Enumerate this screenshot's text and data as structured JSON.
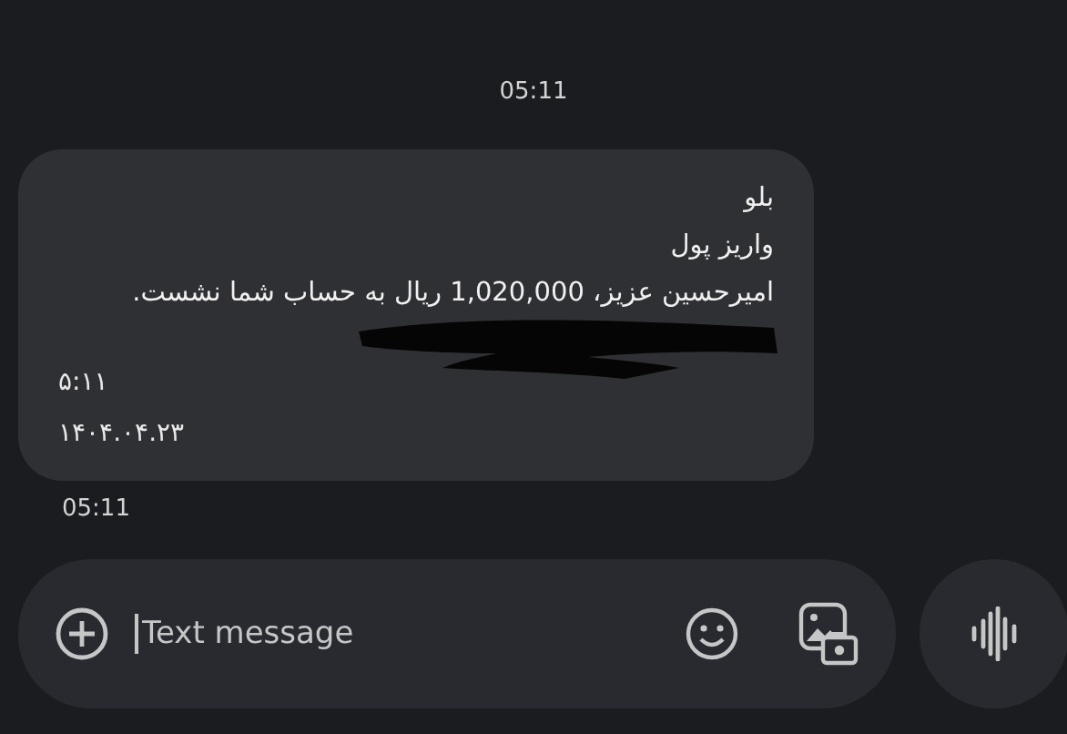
{
  "header_time": "05:11",
  "message": {
    "lines": [
      "بلو",
      "واریز پول",
      "امیرحسین عزیز، 1,020,000 ریال به حساب شما نشست."
    ],
    "redacted": true,
    "time": "۵:۱۱",
    "date": "۱۴۰۴.۰۴.۲۳"
  },
  "message_time": "05:11",
  "composer": {
    "placeholder": "Text message"
  }
}
